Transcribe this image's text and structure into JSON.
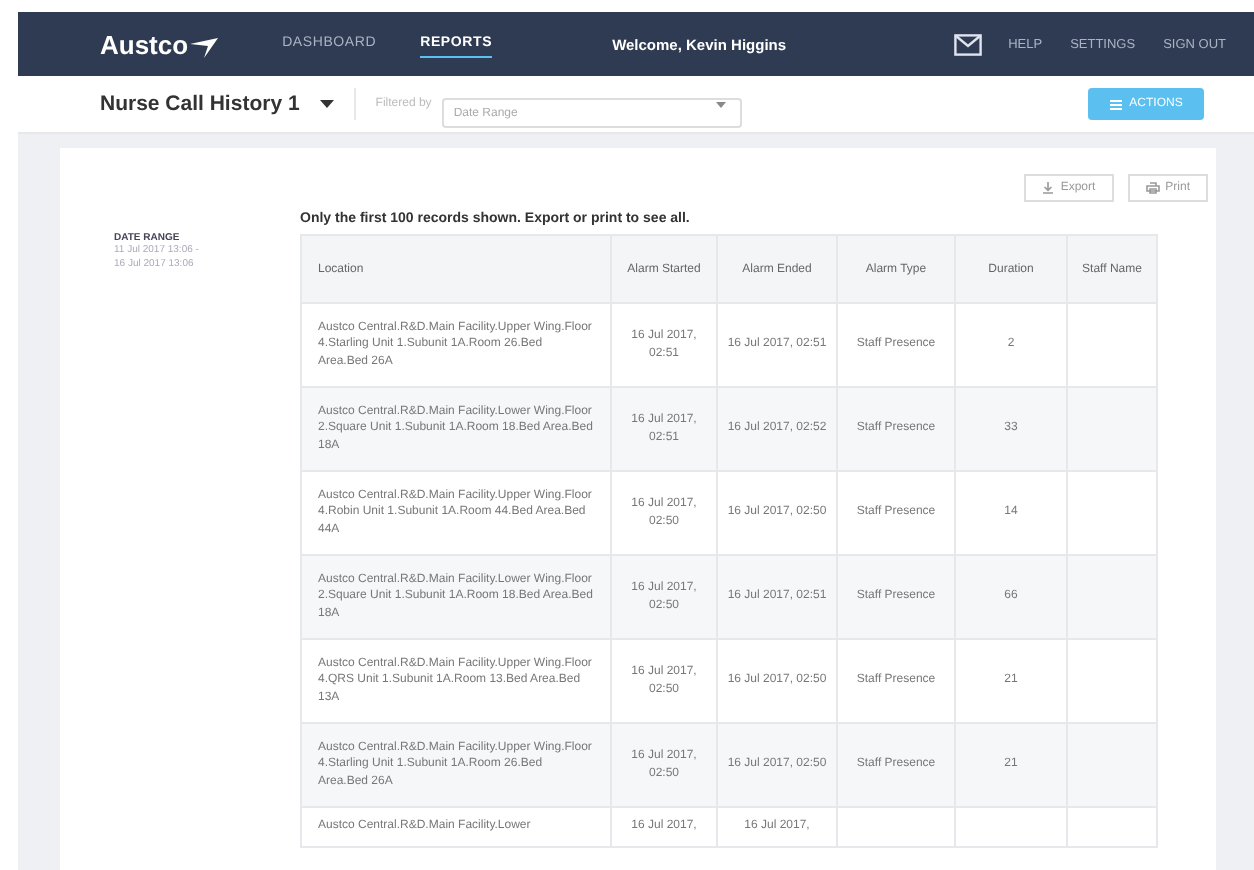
{
  "header": {
    "logo": "Austco",
    "nav": [
      {
        "label": "DASHBOARD",
        "selected": false
      },
      {
        "label": "REPORTS",
        "selected": true
      }
    ],
    "welcome": "Welcome, Kevin Higgins",
    "links": [
      "HELP",
      "SETTINGS",
      "SIGN OUT"
    ]
  },
  "toolbar": {
    "report_title": "Nurse Call History 1",
    "filter_label": "Filtered by",
    "filter": {
      "placeholder": "Date Range"
    },
    "actions_button": "ACTIONS"
  },
  "sidebar": {
    "heading": "DATE RANGE",
    "range": [
      "11 Jul 2017 13:06 -",
      "16 Jul 2017 13:06"
    ]
  },
  "notice": "Only the first 100 records shown. Export or print to see all.",
  "buttons": [
    {
      "kind": "export",
      "label": "Export"
    },
    {
      "kind": "print",
      "label": "Print"
    }
  ],
  "table": {
    "columns": [
      "Location",
      "Alarm Started",
      "Alarm Ended",
      "Alarm Type",
      "Duration",
      "Staff Name"
    ],
    "rows": [
      [
        "Austco Central.R&D.Main Facility.Upper Wing.Floor 4.Starling Unit 1.Subunit 1A.Room 26.Bed Area.Bed 26A",
        "16 Jul 2017, 02:51",
        "16 Jul 2017, 02:51",
        "Staff Presence",
        "2",
        ""
      ],
      [
        "Austco Central.R&D.Main Facility.Lower Wing.Floor 2.Square Unit 1.Subunit 1A.Room 18.Bed Area.Bed 18A",
        "16 Jul 2017, 02:51",
        "16 Jul 2017, 02:52",
        "Staff Presence",
        "33",
        ""
      ],
      [
        "Austco Central.R&D.Main Facility.Upper Wing.Floor 4.Robin Unit 1.Subunit 1A.Room 44.Bed Area.Bed 44A",
        "16 Jul 2017, 02:50",
        "16 Jul 2017, 02:50",
        "Staff Presence",
        "14",
        ""
      ],
      [
        "Austco Central.R&D.Main Facility.Lower Wing.Floor 2.Square Unit 1.Subunit 1A.Room 18.Bed Area.Bed 18A",
        "16 Jul 2017, 02:50",
        "16 Jul 2017, 02:51",
        "Staff Presence",
        "66",
        ""
      ],
      [
        "Austco Central.R&D.Main Facility.Upper Wing.Floor 4.QRS Unit 1.Subunit 1A.Room 13.Bed Area.Bed 13A",
        "16 Jul 2017, 02:50",
        "16 Jul 2017, 02:50",
        "Staff Presence",
        "21",
        ""
      ],
      [
        "Austco Central.R&D.Main Facility.Upper Wing.Floor 4.Starling Unit 1.Subunit 1A.Room 26.Bed Area.Bed 26A",
        "16 Jul 2017, 02:50",
        "16 Jul 2017, 02:50",
        "Staff Presence",
        "21",
        ""
      ],
      [
        "Austco Central.R&D.Main Facility.Lower",
        "16 Jul 2017,",
        "16 Jul 2017,",
        "",
        "",
        ""
      ]
    ]
  }
}
